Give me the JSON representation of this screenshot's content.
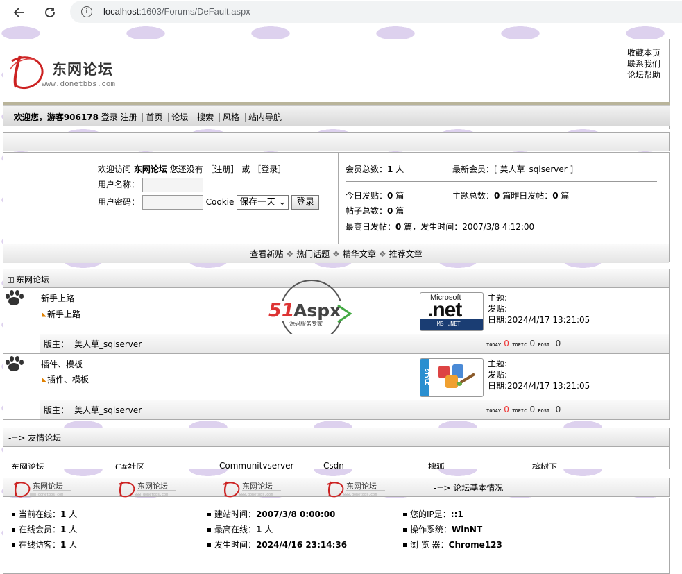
{
  "browser": {
    "url_host": "localhost",
    "url_port_path": ":1603/Forums/DeFault.aspx"
  },
  "header": {
    "logo_title": "东网论坛",
    "logo_url": "www.donetbbs.com",
    "links": [
      "收藏本页",
      "联系我们",
      "论坛帮助"
    ]
  },
  "navbar": {
    "welcome": "欢迎您，游客906178",
    "login": "登录",
    "register": "注册",
    "items": [
      "首页",
      "论坛",
      "搜索",
      "风格",
      "站内导航"
    ]
  },
  "login": {
    "visit_prefix": "欢迎访问",
    "site_name": "东网论坛",
    "not_yet": "您还没有",
    "register_link": "［注册］",
    "or": "或",
    "login_link": "［登录］",
    "username_label": "用户名称：",
    "password_label": "用户密码：",
    "cookie_label": "Cookie",
    "cookie_option": "保存一天",
    "login_button": "登录"
  },
  "stats": {
    "members_label": "会员总数：",
    "members_value": "1",
    "members_unit": "人",
    "newest_label": "最新会员：[",
    "newest_value": "美人草_sqlserver",
    "newest_close": "]",
    "today_label": "今日发贴：",
    "today_value": "0",
    "today_unit": "篇",
    "topics_label": "主题总数：",
    "topics_value": "0",
    "topics_unit": "篇",
    "yesterday_label": "昨日发帖：",
    "yesterday_value": "0",
    "yesterday_unit": "篇",
    "posts_label": "帖子总数：",
    "posts_value": "0",
    "posts_unit": "篇",
    "max_label": "最高日发帖：",
    "max_value": "0",
    "max_unit": "篇，发生时间：",
    "max_time": "2007/3/8 4:12:00"
  },
  "quicklinks": [
    "查看新贴",
    "热门话题",
    "精华文章",
    "推荐文章"
  ],
  "quick_sep": "❖",
  "category": {
    "title": "东网论坛",
    "forums": [
      {
        "name": "新手上路",
        "sub": "新手上路",
        "moderator_label": "版主：",
        "moderator": "美人草_sqlserver",
        "topic_label": "主题:",
        "post_label": "发贴:",
        "date_label": "日期:",
        "date": "2024/4/17 13:21:05",
        "today_tag": "TODAY",
        "today": "0",
        "topic_tag": "TOPIC",
        "topic": "0",
        "post_tag": "POST",
        "post": "0"
      },
      {
        "name": "插件、模板",
        "sub": "插件、模板",
        "moderator_label": "版主：",
        "moderator": "美人草_sqlserver",
        "topic_label": "主题:",
        "post_label": "发贴:",
        "date_label": "日期:",
        "date": "2024/4/17 13:21:05",
        "today_tag": "TODAY",
        "today": "0",
        "topic_tag": "TOPIC",
        "topic": "0",
        "post_tag": "POST",
        "post": "0"
      }
    ]
  },
  "watermark": {
    "text": "51Aspx",
    "sub": "源码服务专家"
  },
  "net_logo": {
    "top": "Microsoft",
    "main": ".net",
    "bottom": "MS .NET"
  },
  "style_logo": "STYLE",
  "friends": {
    "title": "-=> 友情论坛",
    "links": [
      "东网论坛",
      "C#社区",
      "Communityserver",
      "Csdn",
      "搜狐",
      "榕树下"
    ]
  },
  "basic": {
    "title": "-=> 论坛基本情况",
    "online_label": "当前在线：",
    "online_value": "1",
    "online_unit": "人",
    "online_members_label": "在线会员：",
    "online_members_value": "1",
    "online_members_unit": "人",
    "online_guests_label": "在线访客：",
    "online_guests_value": "1",
    "online_guests_unit": "人",
    "built_label": "建站时间：",
    "built_value": "2007/3/8 0:00:00",
    "max_online_label": "最高在线：",
    "max_online_value": "1",
    "max_online_unit": "人",
    "happened_label": "发生时间：",
    "happened_value": "2024/4/16 23:14:36",
    "ip_label": "您的IP是：",
    "ip_value": "::1",
    "os_label": "操作系统：",
    "os_value": "WinNT",
    "browser_label": "浏 览 器：",
    "browser_value": "Chrome123"
  },
  "colors": {
    "pattern": "#ddd1ee",
    "header_rule": "#b9b49a",
    "red_counter": "#e33333"
  }
}
